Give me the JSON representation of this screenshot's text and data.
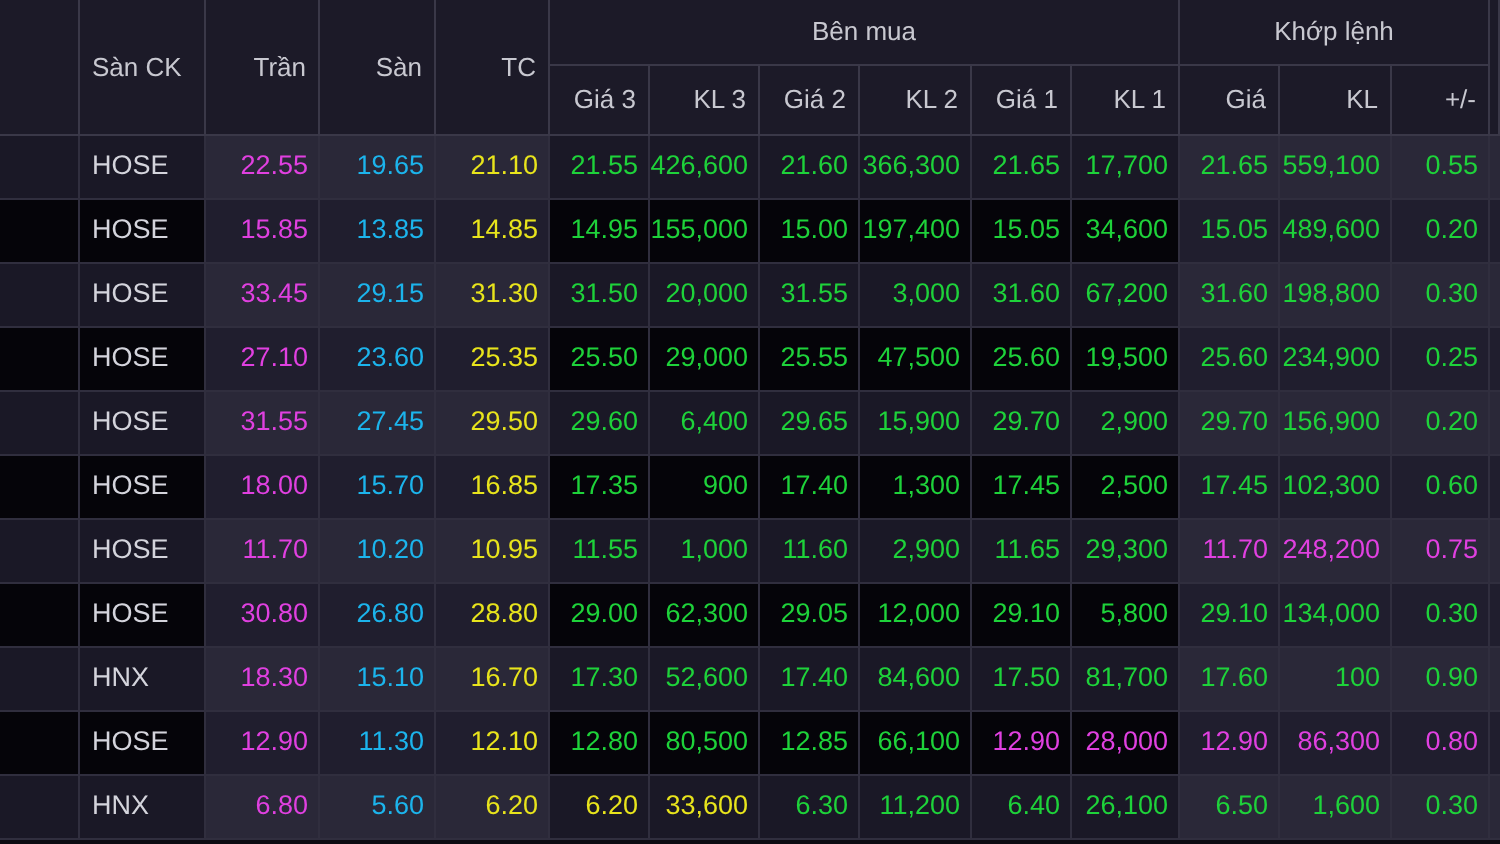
{
  "header": {
    "columns": [
      "Sàn CK",
      "Trần",
      "Sàn",
      "TC"
    ],
    "groups": [
      {
        "label": "Bên mua",
        "columns": [
          "Giá 3",
          "KL 3",
          "Giá 2",
          "KL 2",
          "Giá 1",
          "KL 1"
        ]
      },
      {
        "label": "Khớp lệnh",
        "columns": [
          "Giá",
          "KL",
          "+/-"
        ]
      }
    ]
  },
  "rows": [
    {
      "exchange": "HOSE",
      "cells": [
        {
          "text": "22.55",
          "kind": "ceiling"
        },
        {
          "text": "19.65",
          "kind": "floor"
        },
        {
          "text": "21.10",
          "kind": "reference"
        },
        {
          "text": "21.55",
          "kind": "up"
        },
        {
          "text": "426,600",
          "kind": "up"
        },
        {
          "text": "21.60",
          "kind": "up"
        },
        {
          "text": "366,300",
          "kind": "up"
        },
        {
          "text": "21.65",
          "kind": "up"
        },
        {
          "text": "17,700",
          "kind": "up"
        },
        {
          "text": "21.65",
          "kind": "up"
        },
        {
          "text": "559,100",
          "kind": "up"
        },
        {
          "text": "0.55",
          "kind": "up"
        }
      ]
    },
    {
      "exchange": "HOSE",
      "cells": [
        {
          "text": "15.85",
          "kind": "ceiling"
        },
        {
          "text": "13.85",
          "kind": "floor"
        },
        {
          "text": "14.85",
          "kind": "reference"
        },
        {
          "text": "14.95",
          "kind": "up"
        },
        {
          "text": "155,000",
          "kind": "up"
        },
        {
          "text": "15.00",
          "kind": "up"
        },
        {
          "text": "197,400",
          "kind": "up"
        },
        {
          "text": "15.05",
          "kind": "up"
        },
        {
          "text": "34,600",
          "kind": "up"
        },
        {
          "text": "15.05",
          "kind": "up"
        },
        {
          "text": "489,600",
          "kind": "up"
        },
        {
          "text": "0.20",
          "kind": "up"
        }
      ]
    },
    {
      "exchange": "HOSE",
      "cells": [
        {
          "text": "33.45",
          "kind": "ceiling"
        },
        {
          "text": "29.15",
          "kind": "floor"
        },
        {
          "text": "31.30",
          "kind": "reference"
        },
        {
          "text": "31.50",
          "kind": "up"
        },
        {
          "text": "20,000",
          "kind": "up"
        },
        {
          "text": "31.55",
          "kind": "up"
        },
        {
          "text": "3,000",
          "kind": "up"
        },
        {
          "text": "31.60",
          "kind": "up"
        },
        {
          "text": "67,200",
          "kind": "up"
        },
        {
          "text": "31.60",
          "kind": "up"
        },
        {
          "text": "198,800",
          "kind": "up"
        },
        {
          "text": "0.30",
          "kind": "up"
        }
      ]
    },
    {
      "exchange": "HOSE",
      "cells": [
        {
          "text": "27.10",
          "kind": "ceiling"
        },
        {
          "text": "23.60",
          "kind": "floor"
        },
        {
          "text": "25.35",
          "kind": "reference"
        },
        {
          "text": "25.50",
          "kind": "up"
        },
        {
          "text": "29,000",
          "kind": "up"
        },
        {
          "text": "25.55",
          "kind": "up"
        },
        {
          "text": "47,500",
          "kind": "up"
        },
        {
          "text": "25.60",
          "kind": "up"
        },
        {
          "text": "19,500",
          "kind": "up"
        },
        {
          "text": "25.60",
          "kind": "up"
        },
        {
          "text": "234,900",
          "kind": "up"
        },
        {
          "text": "0.25",
          "kind": "up"
        }
      ]
    },
    {
      "exchange": "HOSE",
      "cells": [
        {
          "text": "31.55",
          "kind": "ceiling"
        },
        {
          "text": "27.45",
          "kind": "floor"
        },
        {
          "text": "29.50",
          "kind": "reference"
        },
        {
          "text": "29.60",
          "kind": "up"
        },
        {
          "text": "6,400",
          "kind": "up"
        },
        {
          "text": "29.65",
          "kind": "up"
        },
        {
          "text": "15,900",
          "kind": "up"
        },
        {
          "text": "29.70",
          "kind": "up"
        },
        {
          "text": "2,900",
          "kind": "up"
        },
        {
          "text": "29.70",
          "kind": "up"
        },
        {
          "text": "156,900",
          "kind": "up"
        },
        {
          "text": "0.20",
          "kind": "up"
        }
      ]
    },
    {
      "exchange": "HOSE",
      "cells": [
        {
          "text": "18.00",
          "kind": "ceiling"
        },
        {
          "text": "15.70",
          "kind": "floor"
        },
        {
          "text": "16.85",
          "kind": "reference"
        },
        {
          "text": "17.35",
          "kind": "up"
        },
        {
          "text": "900",
          "kind": "up"
        },
        {
          "text": "17.40",
          "kind": "up"
        },
        {
          "text": "1,300",
          "kind": "up"
        },
        {
          "text": "17.45",
          "kind": "up"
        },
        {
          "text": "2,500",
          "kind": "up"
        },
        {
          "text": "17.45",
          "kind": "up"
        },
        {
          "text": "102,300",
          "kind": "up"
        },
        {
          "text": "0.60",
          "kind": "up"
        }
      ]
    },
    {
      "exchange": "HOSE",
      "cells": [
        {
          "text": "11.70",
          "kind": "ceiling"
        },
        {
          "text": "10.20",
          "kind": "floor"
        },
        {
          "text": "10.95",
          "kind": "reference"
        },
        {
          "text": "11.55",
          "kind": "up"
        },
        {
          "text": "1,000",
          "kind": "up"
        },
        {
          "text": "11.60",
          "kind": "up"
        },
        {
          "text": "2,900",
          "kind": "up"
        },
        {
          "text": "11.65",
          "kind": "up"
        },
        {
          "text": "29,300",
          "kind": "up"
        },
        {
          "text": "11.70",
          "kind": "ceiling"
        },
        {
          "text": "248,200",
          "kind": "ceiling"
        },
        {
          "text": "0.75",
          "kind": "ceiling"
        }
      ]
    },
    {
      "exchange": "HOSE",
      "cells": [
        {
          "text": "30.80",
          "kind": "ceiling"
        },
        {
          "text": "26.80",
          "kind": "floor"
        },
        {
          "text": "28.80",
          "kind": "reference"
        },
        {
          "text": "29.00",
          "kind": "up"
        },
        {
          "text": "62,300",
          "kind": "up"
        },
        {
          "text": "29.05",
          "kind": "up"
        },
        {
          "text": "12,000",
          "kind": "up"
        },
        {
          "text": "29.10",
          "kind": "up"
        },
        {
          "text": "5,800",
          "kind": "up"
        },
        {
          "text": "29.10",
          "kind": "up"
        },
        {
          "text": "134,000",
          "kind": "up"
        },
        {
          "text": "0.30",
          "kind": "up"
        }
      ]
    },
    {
      "exchange": "HNX",
      "cells": [
        {
          "text": "18.30",
          "kind": "ceiling"
        },
        {
          "text": "15.10",
          "kind": "floor"
        },
        {
          "text": "16.70",
          "kind": "reference"
        },
        {
          "text": "17.30",
          "kind": "up"
        },
        {
          "text": "52,600",
          "kind": "up"
        },
        {
          "text": "17.40",
          "kind": "up"
        },
        {
          "text": "84,600",
          "kind": "up"
        },
        {
          "text": "17.50",
          "kind": "up"
        },
        {
          "text": "81,700",
          "kind": "up"
        },
        {
          "text": "17.60",
          "kind": "up"
        },
        {
          "text": "100",
          "kind": "up"
        },
        {
          "text": "0.90",
          "kind": "up"
        }
      ]
    },
    {
      "exchange": "HOSE",
      "cells": [
        {
          "text": "12.90",
          "kind": "ceiling"
        },
        {
          "text": "11.30",
          "kind": "floor"
        },
        {
          "text": "12.10",
          "kind": "reference"
        },
        {
          "text": "12.80",
          "kind": "up"
        },
        {
          "text": "80,500",
          "kind": "up"
        },
        {
          "text": "12.85",
          "kind": "up"
        },
        {
          "text": "66,100",
          "kind": "up"
        },
        {
          "text": "12.90",
          "kind": "ceiling"
        },
        {
          "text": "28,000",
          "kind": "ceiling"
        },
        {
          "text": "12.90",
          "kind": "ceiling"
        },
        {
          "text": "86,300",
          "kind": "ceiling"
        },
        {
          "text": "0.80",
          "kind": "ceiling"
        }
      ]
    },
    {
      "exchange": "HNX",
      "cells": [
        {
          "text": "6.80",
          "kind": "ceiling"
        },
        {
          "text": "5.60",
          "kind": "floor"
        },
        {
          "text": "6.20",
          "kind": "reference"
        },
        {
          "text": "6.20",
          "kind": "reference"
        },
        {
          "text": "33,600",
          "kind": "reference"
        },
        {
          "text": "6.30",
          "kind": "up"
        },
        {
          "text": "11,200",
          "kind": "up"
        },
        {
          "text": "6.40",
          "kind": "up"
        },
        {
          "text": "26,100",
          "kind": "up"
        },
        {
          "text": "6.50",
          "kind": "up"
        },
        {
          "text": "1,600",
          "kind": "up"
        },
        {
          "text": "0.30",
          "kind": "up"
        }
      ]
    }
  ]
}
